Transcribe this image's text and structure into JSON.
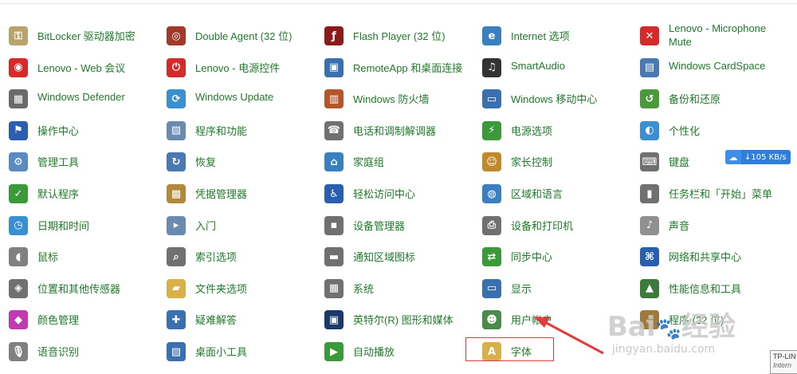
{
  "items": [
    {
      "label": "BitLocker 驱动器加密",
      "icon": "bitlocker-key-icon",
      "color": "#b8a36a"
    },
    {
      "label": "Double Agent (32 位)",
      "icon": "double-agent-icon",
      "color": "#a03a2a"
    },
    {
      "label": "Flash Player (32 位)",
      "icon": "flash-player-icon",
      "color": "#8b1a1a"
    },
    {
      "label": "Internet 选项",
      "icon": "internet-options-icon",
      "color": "#3a7fc0"
    },
    {
      "label": "Lenovo - Microphone Mute",
      "icon": "microphone-mute-icon",
      "color": "#d42a2a"
    },
    {
      "label": "Lenovo - Web 会议",
      "icon": "web-meeting-icon",
      "color": "#d42a2a"
    },
    {
      "label": "Lenovo - 电源控件",
      "icon": "power-control-icon",
      "color": "#d42a2a"
    },
    {
      "label": "RemoteApp 和桌面连接",
      "icon": "remoteapp-icon",
      "color": "#3a6fb0"
    },
    {
      "label": "SmartAudio",
      "icon": "smartaudio-icon",
      "color": "#333333"
    },
    {
      "label": "Windows CardSpace",
      "icon": "cardspace-icon",
      "color": "#4a78b0"
    },
    {
      "label": "Windows Defender",
      "icon": "defender-icon",
      "color": "#6a6a6a"
    },
    {
      "label": "Windows Update",
      "icon": "windows-update-icon",
      "color": "#3a8fd0"
    },
    {
      "label": "Windows 防火墙",
      "icon": "firewall-icon",
      "color": "#b5552a"
    },
    {
      "label": "Windows 移动中心",
      "icon": "mobility-center-icon",
      "color": "#3a6fb0"
    },
    {
      "label": "备份和还原",
      "icon": "backup-restore-icon",
      "color": "#4a9a3a"
    },
    {
      "label": "操作中心",
      "icon": "action-center-flag-icon",
      "color": "#2a5fb0"
    },
    {
      "label": "程序和功能",
      "icon": "programs-features-icon",
      "color": "#6a8ab0"
    },
    {
      "label": "电话和调制解调器",
      "icon": "phone-modem-icon",
      "color": "#707070"
    },
    {
      "label": "电源选项",
      "icon": "power-options-icon",
      "color": "#3a9a3a"
    },
    {
      "label": "个性化",
      "icon": "personalization-icon",
      "color": "#3a8fd0"
    },
    {
      "label": "管理工具",
      "icon": "admin-tools-icon",
      "color": "#5a8ac0"
    },
    {
      "label": "恢复",
      "icon": "recovery-icon",
      "color": "#4a78b0"
    },
    {
      "label": "家庭组",
      "icon": "homegroup-icon",
      "color": "#3a7fc0"
    },
    {
      "label": "家长控制",
      "icon": "parental-controls-icon",
      "color": "#c08a2a"
    },
    {
      "label": "键盘",
      "icon": "keyboard-icon",
      "color": "#707070"
    },
    {
      "label": "默认程序",
      "icon": "default-programs-icon",
      "color": "#3a9a3a"
    },
    {
      "label": "凭据管理器",
      "icon": "credential-manager-icon",
      "color": "#b08a3a"
    },
    {
      "label": "轻松访问中心",
      "icon": "ease-of-access-icon",
      "color": "#2a5fb0"
    },
    {
      "label": "区域和语言",
      "icon": "region-language-icon",
      "color": "#3a7fc0"
    },
    {
      "label": "任务栏和「开始」菜单",
      "icon": "taskbar-start-icon",
      "color": "#707070"
    },
    {
      "label": "日期和时间",
      "icon": "date-time-icon",
      "color": "#3a8fd0"
    },
    {
      "label": "入门",
      "icon": "getting-started-icon",
      "color": "#6a8ab0"
    },
    {
      "label": "设备管理器",
      "icon": "device-manager-icon",
      "color": "#707070"
    },
    {
      "label": "设备和打印机",
      "icon": "devices-printers-icon",
      "color": "#707070"
    },
    {
      "label": "声音",
      "icon": "sound-icon",
      "color": "#909090"
    },
    {
      "label": "鼠标",
      "icon": "mouse-icon",
      "color": "#808080"
    },
    {
      "label": "索引选项",
      "icon": "indexing-options-icon",
      "color": "#707070"
    },
    {
      "label": "通知区域图标",
      "icon": "notification-area-icon",
      "color": "#707070"
    },
    {
      "label": "同步中心",
      "icon": "sync-center-icon",
      "color": "#3a9a3a"
    },
    {
      "label": "网络和共享中心",
      "icon": "network-sharing-icon",
      "color": "#2a5fb0"
    },
    {
      "label": "位置和其他传感器",
      "icon": "location-sensors-icon",
      "color": "#707070"
    },
    {
      "label": "文件夹选项",
      "icon": "folder-options-icon",
      "color": "#d8b04a"
    },
    {
      "label": "系统",
      "icon": "system-icon",
      "color": "#707070"
    },
    {
      "label": "显示",
      "icon": "display-icon",
      "color": "#3a6fb0"
    },
    {
      "label": "性能信息和工具",
      "icon": "performance-tools-icon",
      "color": "#3a7a3a"
    },
    {
      "label": "颜色管理",
      "icon": "color-management-icon",
      "color": "#c03ab0"
    },
    {
      "label": "疑难解答",
      "icon": "troubleshooting-icon",
      "color": "#3a6fb0"
    },
    {
      "label": "英特尔(R) 图形和媒体",
      "icon": "intel-graphics-icon",
      "color": "#1a3a6a"
    },
    {
      "label": "用户帐户",
      "icon": "user-accounts-icon",
      "color": "#4a8a4a"
    },
    {
      "label": "程序 (32 位)",
      "icon": "java-icon",
      "color": "#a07a3a"
    },
    {
      "label": "语音识别",
      "icon": "speech-recognition-icon",
      "color": "#808080"
    },
    {
      "label": "桌面小工具",
      "icon": "desktop-gadgets-icon",
      "color": "#3a6fb0"
    },
    {
      "label": "自动播放",
      "icon": "autoplay-icon",
      "color": "#3a9a3a"
    },
    {
      "label": "字体",
      "icon": "fonts-icon",
      "color": "#d8b04a"
    }
  ],
  "network_speed": {
    "text": "↓105 KB/s",
    "icon": "cloud-icon"
  },
  "highlight_color": "#e23c3c",
  "watermark": {
    "text": "Baidu经验",
    "url": "jingyan.baidu.com"
  },
  "tooltip": {
    "title": "TP-LIN",
    "subtitle": "Intern"
  }
}
